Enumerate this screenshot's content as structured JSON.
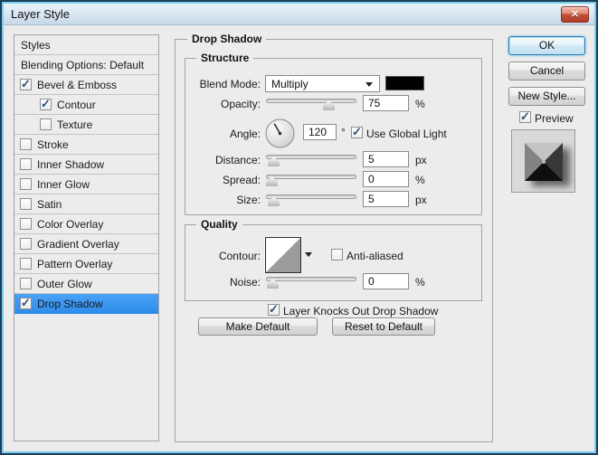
{
  "window": {
    "title": "Layer Style",
    "close_glyph": "✕"
  },
  "sidebar": {
    "header": "Styles",
    "items": [
      {
        "label": "Blending Options: Default",
        "type": "plain"
      },
      {
        "label": "Bevel & Emboss",
        "checked": true
      },
      {
        "label": "Contour",
        "checked": true,
        "indent": true
      },
      {
        "label": "Texture",
        "checked": false,
        "indent": true
      },
      {
        "label": "Stroke",
        "checked": false
      },
      {
        "label": "Inner Shadow",
        "checked": false
      },
      {
        "label": "Inner Glow",
        "checked": false
      },
      {
        "label": "Satin",
        "checked": false
      },
      {
        "label": "Color Overlay",
        "checked": false
      },
      {
        "label": "Gradient Overlay",
        "checked": false
      },
      {
        "label": "Pattern Overlay",
        "checked": false
      },
      {
        "label": "Outer Glow",
        "checked": false
      },
      {
        "label": "Drop Shadow",
        "checked": true,
        "selected": true
      }
    ]
  },
  "panel": {
    "title": "Drop Shadow",
    "structure": {
      "title": "Structure",
      "blend_mode_label": "Blend Mode:",
      "blend_mode_value": "Multiply",
      "blend_color": "#000000",
      "opacity_label": "Opacity:",
      "opacity_value": "75",
      "opacity_unit": "%",
      "angle_label": "Angle:",
      "angle_value": "120",
      "angle_unit": "°",
      "use_global_light_label": "Use Global Light",
      "use_global_light_checked": true,
      "distance_label": "Distance:",
      "distance_value": "5",
      "distance_unit": "px",
      "spread_label": "Spread:",
      "spread_value": "0",
      "spread_unit": "%",
      "size_label": "Size:",
      "size_value": "5",
      "size_unit": "px"
    },
    "quality": {
      "title": "Quality",
      "contour_label": "Contour:",
      "anti_aliased_label": "Anti-aliased",
      "anti_aliased_checked": false,
      "noise_label": "Noise:",
      "noise_value": "0",
      "noise_unit": "%"
    },
    "knockout_label": "Layer Knocks Out Drop Shadow",
    "knockout_checked": true,
    "make_default_label": "Make Default",
    "reset_default_label": "Reset to Default"
  },
  "actions": {
    "ok": "OK",
    "cancel": "Cancel",
    "new_style": "New Style...",
    "preview_label": "Preview",
    "preview_checked": true
  },
  "colors": {
    "selection_blue": "#3999ff",
    "swatch_black": "#000000"
  }
}
